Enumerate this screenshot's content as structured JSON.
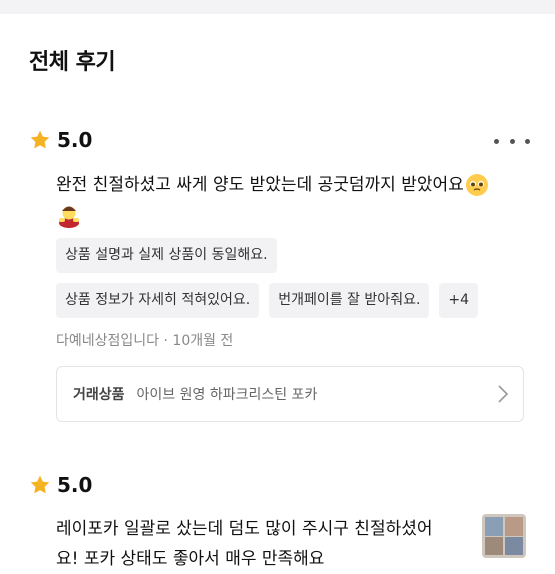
{
  "page": {
    "title": "전체 후기"
  },
  "reviews": [
    {
      "rating": "5.0",
      "text": "완전 친절하셨고 싸게 양도 받았는데 공굿덤까지 받았어요",
      "tags": [
        "상품 설명과 실제 상품이 동일해요.",
        "상품 정보가 자세히 적혀있어요.",
        "번개페이를 잘 받아줘요.",
        "+4"
      ],
      "seller": "다예네상점입니다",
      "separator": "·",
      "time": "10개월 전",
      "product_label": "거래상품",
      "product_name": "아이브 원영 하파크리스틴 포카"
    },
    {
      "rating": "5.0",
      "text": "레이포카 일괄로 샀는데 덤도 많이 주시구 친절하셨어",
      "text_partial": "요! 포카 상태도 좋아서 매우 만족해요"
    }
  ],
  "icons": {
    "star": "star-icon",
    "more": "more-icon",
    "chevron": "chevron-right-icon"
  },
  "colors": {
    "star": "#F5B324",
    "tag_bg": "#F2F2F4",
    "meta_text": "#888888",
    "border": "#E4E4E6"
  }
}
